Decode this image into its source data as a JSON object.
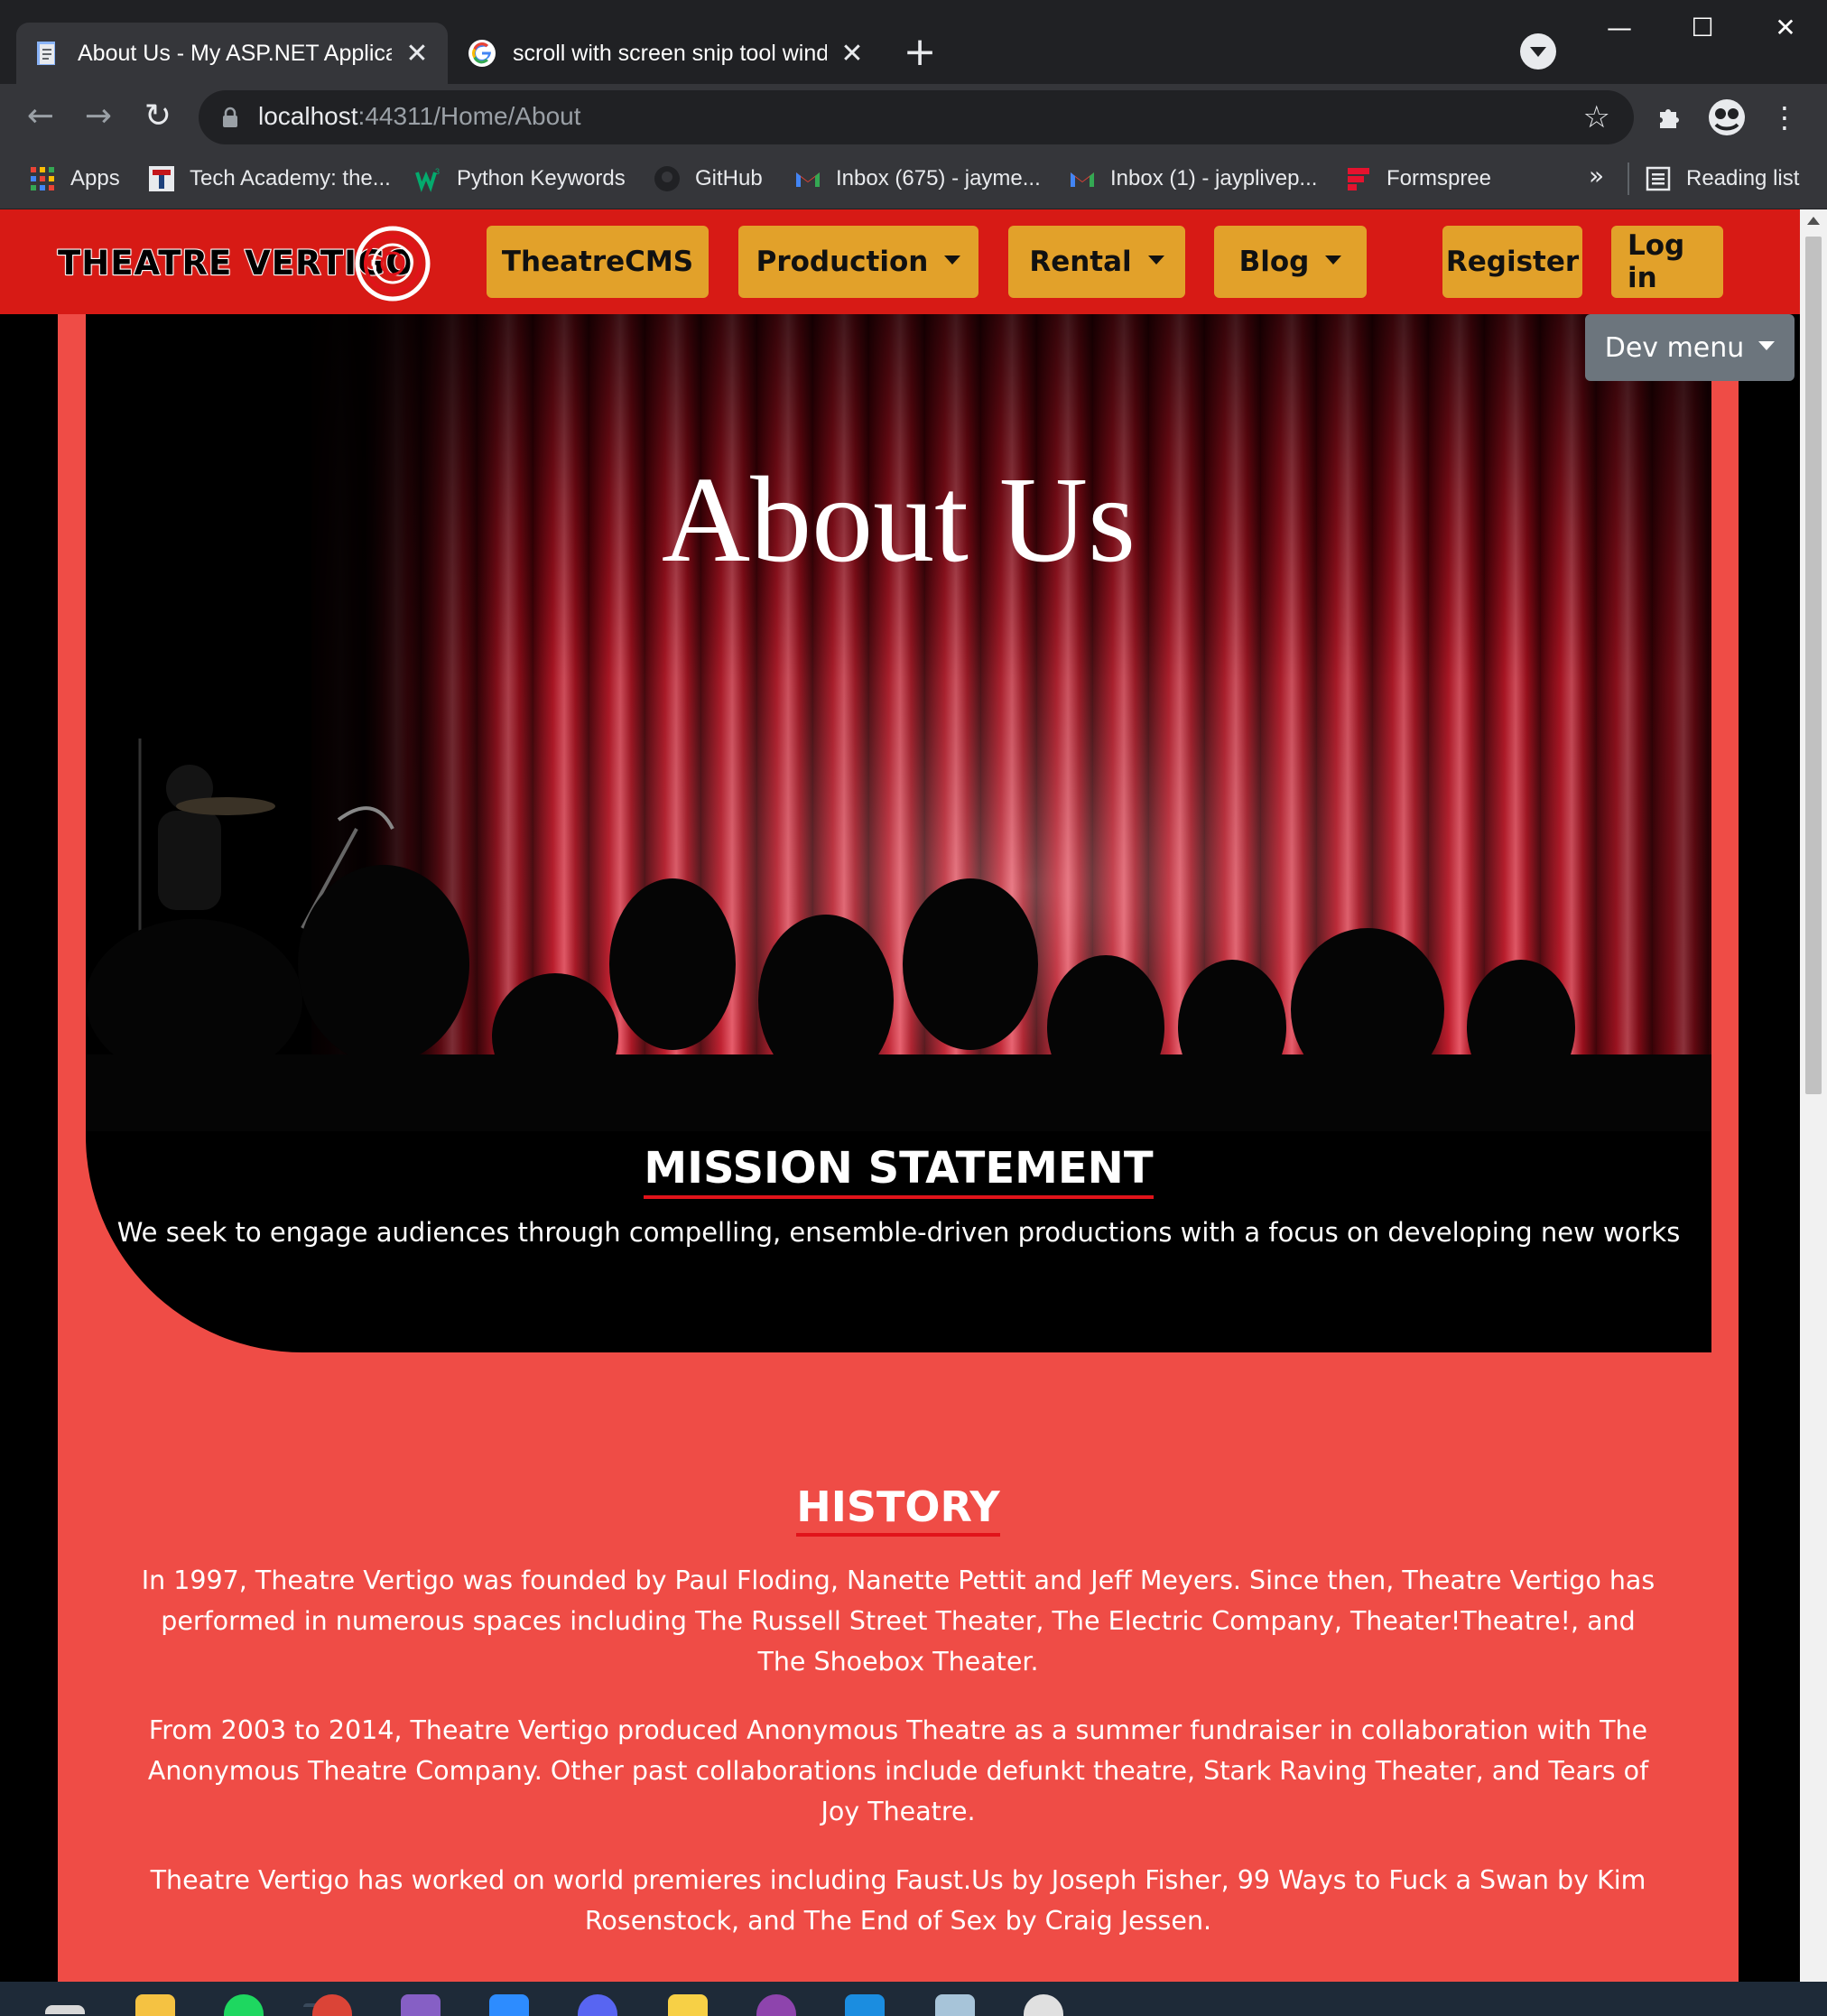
{
  "browser": {
    "tabs": [
      {
        "title": "About Us - My ASP.NET Applicati",
        "active": true,
        "favicon": "page-icon"
      },
      {
        "title": "scroll with screen snip tool windo",
        "active": false,
        "favicon": "google-icon"
      }
    ],
    "new_tab_symbol": "+",
    "window_controls": {
      "minimize": "—",
      "maximize": "☐",
      "close": "✕"
    },
    "url_host": "localhost",
    "url_rest": ":44311/Home/About",
    "bookmarks": [
      {
        "label": "Apps",
        "icon": "apps-grid-icon"
      },
      {
        "label": "Tech Academy: the...",
        "icon": "tech-academy-icon"
      },
      {
        "label": "Python Keywords",
        "icon": "w3schools-icon"
      },
      {
        "label": "GitHub",
        "icon": "github-icon"
      },
      {
        "label": "Inbox (675) - jayme...",
        "icon": "gmail-icon"
      },
      {
        "label": "Inbox (1) - jayplivep...",
        "icon": "gmail-icon"
      },
      {
        "label": "Formspree",
        "icon": "formspree-icon"
      }
    ],
    "bookmarks_overflow": "»",
    "reading_list": "Reading list"
  },
  "site": {
    "logo_text": "THEATRE VERTIGO",
    "nav": [
      {
        "label": "TheatreCMS",
        "dropdown": false
      },
      {
        "label": "Production",
        "dropdown": true
      },
      {
        "label": "Rental",
        "dropdown": true
      },
      {
        "label": "Blog",
        "dropdown": true
      }
    ],
    "register": "Register",
    "login": "Log in",
    "dev_menu": "Dev menu",
    "colors": {
      "navbar": "#d71a15",
      "nav_button": "#e2a12a",
      "panel": "#ef4c46",
      "underline": "#e1131a"
    }
  },
  "hero": {
    "title": "About Us",
    "mission_heading": "MISSION STATEMENT",
    "mission_text": "We seek to engage audiences through compelling, ensemble-driven productions with a focus on developing new works"
  },
  "history": {
    "heading": "HISTORY",
    "paragraphs": [
      "In 1997, Theatre Vertigo was founded by Paul Floding, Nanette Pettit and Jeff Meyers. Since then, Theatre Vertigo has performed in numerous spaces including The Russell Street Theater, The Electric Company, Theater!Theatre!, and The Shoebox Theater.",
      "From 2003 to 2014, Theatre Vertigo produced Anonymous Theatre as a summer fundraiser in collaboration with The Anonymous Theatre Company. Other past collaborations include defunkt theatre, Stark Raving Theater, and Tears of Joy Theatre.",
      "Theatre Vertigo has worked on world premieres including Faust.Us by Joseph Fisher, 99 Ways to Fuck a Swan by Kim Rosenstock, and The End of Sex by Craig Jessen."
    ]
  },
  "taskbar": {
    "icons": [
      "task-view-icon",
      "file-explorer-icon",
      "spotify-icon",
      "chrome-icon",
      "visual-studio-icon",
      "zoom-icon",
      "discord-icon",
      "sticky-notes-icon",
      "github-desktop-icon",
      "vscode-icon",
      "notepad-icon",
      "snip-tool-icon"
    ]
  }
}
